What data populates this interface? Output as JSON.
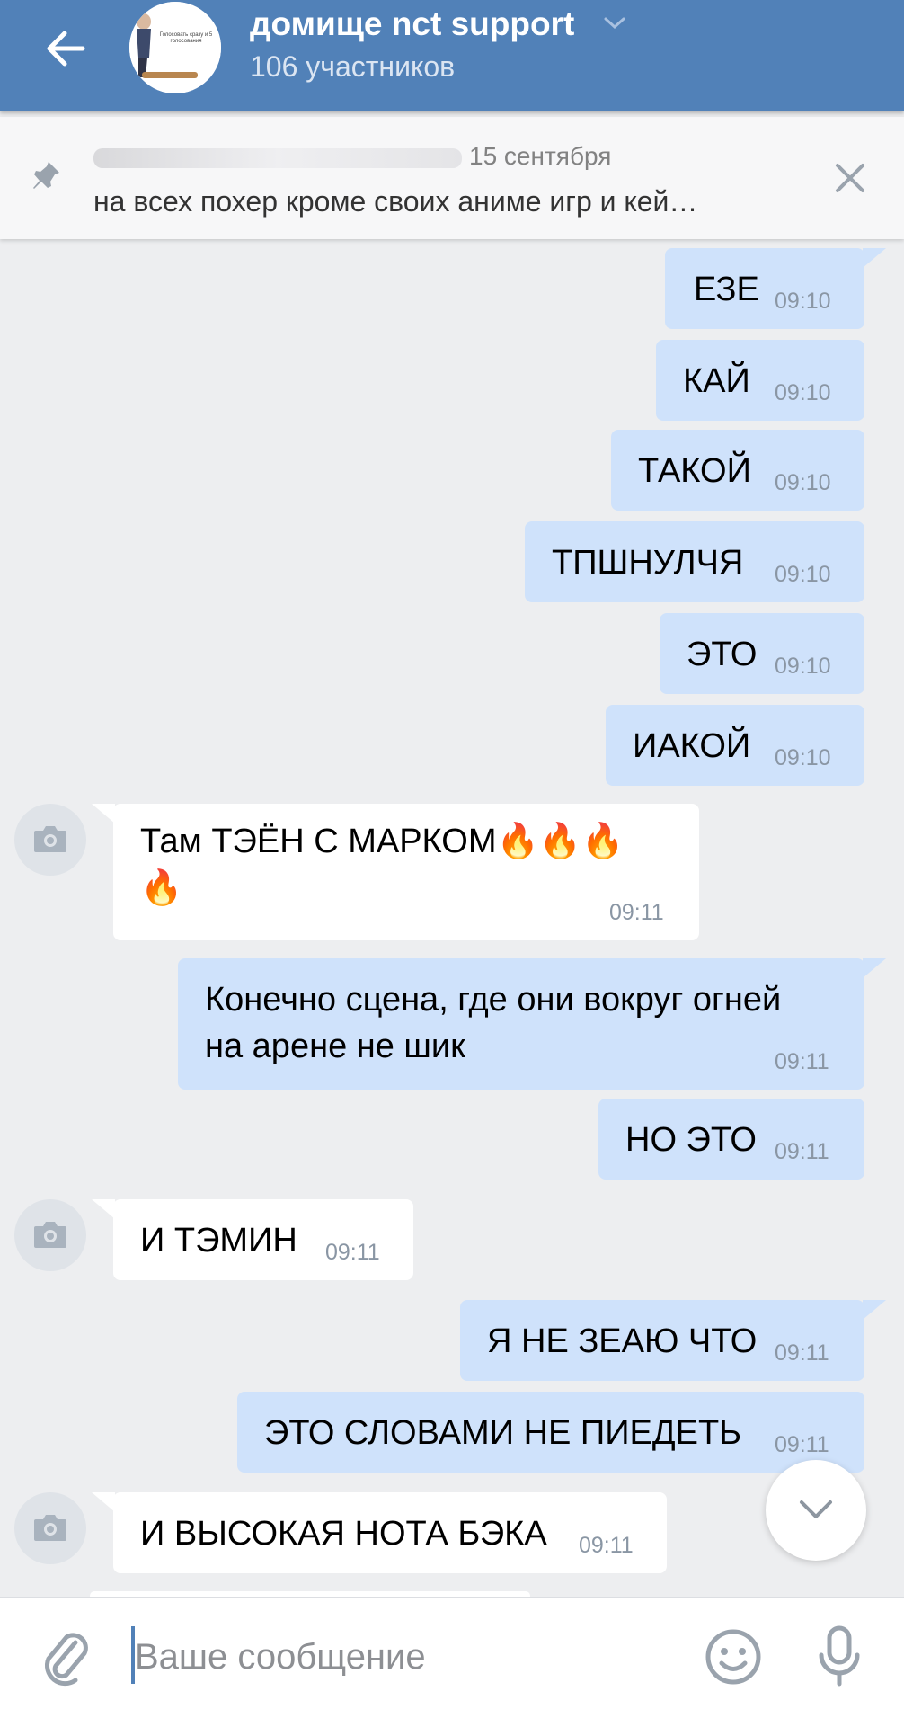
{
  "header": {
    "title": "домище nct support",
    "subtitle": "106 участников",
    "avatar_caption": "Голосовать сразу и 5 голосования"
  },
  "pinned": {
    "date": "15 сентября",
    "text": "на всех похер кроме своих аниме игр и кей…"
  },
  "messages": [
    {
      "dir": "out",
      "text": "ЕЗЕ",
      "time": "09:10"
    },
    {
      "dir": "out",
      "text": "КАЙ",
      "time": "09:10"
    },
    {
      "dir": "out",
      "text": "ТАКОЙ",
      "time": "09:10"
    },
    {
      "dir": "out",
      "text": "ТПШНУЛЧЯ",
      "time": "09:10"
    },
    {
      "dir": "out",
      "text": "ЭТО",
      "time": "09:10"
    },
    {
      "dir": "out",
      "text": "ИАКОЙ",
      "time": "09:10"
    },
    {
      "dir": "in",
      "text": "Там ТЭЁН С МАРКОМ🔥🔥🔥",
      "text2": "🔥",
      "time": "09:11"
    },
    {
      "dir": "out",
      "text": "Конечно сцена, где они вокруг огней",
      "text2": "на арене не шик",
      "time": "09:11"
    },
    {
      "dir": "out",
      "text": "НО ЭТО",
      "time": "09:11"
    },
    {
      "dir": "in",
      "text": "И ТЭМИН",
      "time": "09:11"
    },
    {
      "dir": "out",
      "text": "Я НЕ ЗЕАЮ ЧТО",
      "time": "09:11"
    },
    {
      "dir": "out",
      "text": "ЭТО СЛОВАМИ НЕ ПИЕДЕТЬ",
      "time": "09:11"
    },
    {
      "dir": "in",
      "text": "И ВЫСОКАЯ НОТА БЭКА",
      "time": "09:11"
    }
  ],
  "composer": {
    "placeholder": "Ваше сообщение"
  },
  "icons": {
    "back": "arrow-left-icon",
    "pin": "pin-icon",
    "close": "close-icon",
    "attach": "paperclip-icon",
    "emoji": "smile-icon",
    "mic": "microphone-icon",
    "scroll": "chevron-down-icon",
    "avatar_placeholder": "camera-icon"
  },
  "colors": {
    "header": "#5181b8",
    "outgoing_bubble": "#cfe2fb",
    "incoming_bubble": "#ffffff",
    "background": "#edeef0"
  }
}
